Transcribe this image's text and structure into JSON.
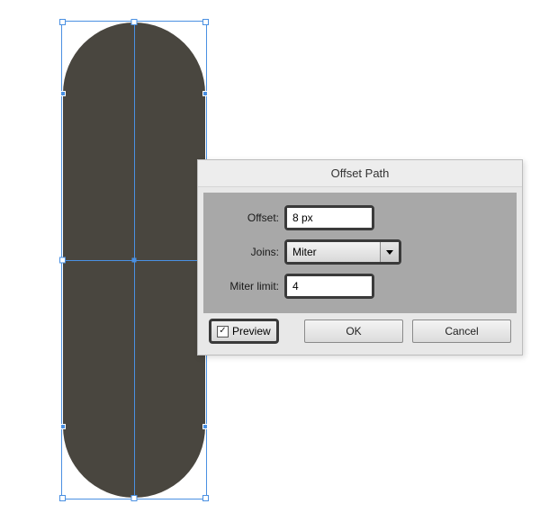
{
  "shape": {
    "fill": "#49463f"
  },
  "dialog": {
    "title": "Offset Path",
    "offset_label": "Offset:",
    "offset_value": "8 px",
    "joins_label": "Joins:",
    "joins_value": "Miter",
    "miter_limit_label": "Miter limit:",
    "miter_limit_value": "4",
    "preview_label": "Preview",
    "preview_checked": "✓",
    "ok_label": "OK",
    "cancel_label": "Cancel"
  }
}
